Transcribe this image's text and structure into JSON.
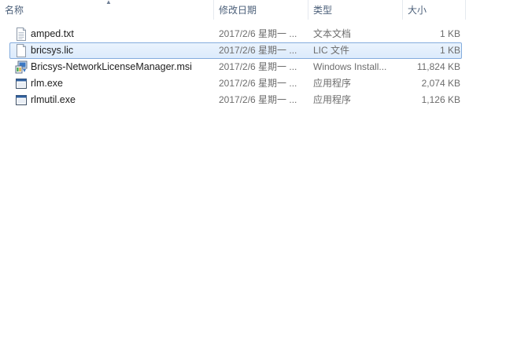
{
  "columns": {
    "name": "名称",
    "date": "修改日期",
    "type": "类型",
    "size": "大小"
  },
  "files": [
    {
      "name": "amped.txt",
      "date": "2017/2/6 星期一 ...",
      "type": "文本文档",
      "size": "1 KB",
      "icon": "text-file-icon",
      "selected": false
    },
    {
      "name": "bricsys.lic",
      "date": "2017/2/6 星期一 ...",
      "type": "LIC 文件",
      "size": "1 KB",
      "icon": "lic-file-icon",
      "selected": true
    },
    {
      "name": "Bricsys-NetworkLicenseManager.msi",
      "date": "2017/2/6 星期一 ...",
      "type": "Windows Install...",
      "size": "11,824 KB",
      "icon": "msi-installer-icon",
      "selected": false
    },
    {
      "name": "rlm.exe",
      "date": "2017/2/6 星期一 ...",
      "type": "应用程序",
      "size": "2,074 KB",
      "icon": "exe-app-icon",
      "selected": false
    },
    {
      "name": "rlmutil.exe",
      "date": "2017/2/6 星期一 ...",
      "type": "应用程序",
      "size": "1,126 KB",
      "icon": "exe-app-icon",
      "selected": false
    }
  ],
  "colors": {
    "header_text": "#4c607a",
    "selection_fill": "#dcebfc",
    "selection_border": "#84acdd"
  }
}
